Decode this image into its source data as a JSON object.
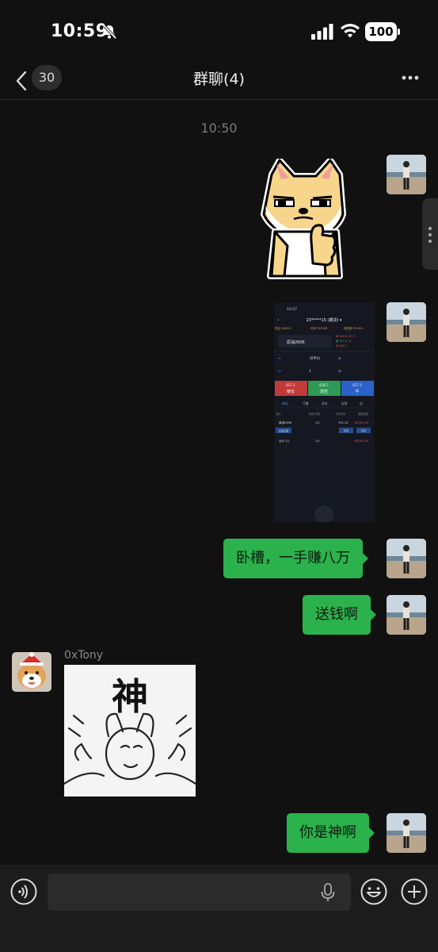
{
  "status_bar": {
    "time": "10:59",
    "battery": "100"
  },
  "nav": {
    "unread_count": "30",
    "title": "群聊(4)"
  },
  "chat": {
    "timestamp": "10:50",
    "messages": [
      {
        "type": "sticker",
        "from": "self"
      },
      {
        "type": "image",
        "from": "self",
        "screenshot": {
          "time": "10:57",
          "account": "23*****15 (期货) ▾",
          "stats": [
            "权益 240401",
            "可用 705926",
            "风险度 59.49%"
          ],
          "contract": "原油2606",
          "price_mode": "对手价",
          "qty": "1",
          "buttons": [
            {
              "price": "617.1",
              "label": "锁仓"
            },
            {
              "price": "616.7",
              "label": "加空"
            },
            {
              "price": "617.1",
              "label": "平"
            }
          ],
          "tabs": [
            "持仓",
            "可撤",
            "成交",
            "走势",
            "自"
          ],
          "headers": [
            "合约",
            "持仓/可用",
            "开仓均价",
            "逐笔浮盈"
          ],
          "row": [
            "原油2606",
            "1/1",
            "701.10",
            "84300.00"
          ],
          "row_buttons": [
            "止损止盈",
            "反手",
            "全平"
          ],
          "total": [
            "合计 (1)",
            "1/1",
            "84300.00"
          ]
        }
      },
      {
        "type": "text",
        "from": "self",
        "text": "卧槽，一手赚八万"
      },
      {
        "type": "text",
        "from": "self",
        "text": "送钱啊"
      },
      {
        "type": "image",
        "from": "other",
        "sender": "0xTony",
        "sticker_char": "神"
      },
      {
        "type": "text",
        "from": "self",
        "text": "你是神啊"
      }
    ]
  },
  "input": {
    "placeholder": ""
  },
  "colors": {
    "bubble": "#2bb24c",
    "background": "#111111",
    "input_bar": "#1c1c1c"
  },
  "icons": [
    "back-chevron-icon",
    "more-icon",
    "voice-icon",
    "mic-icon",
    "emoji-icon",
    "plus-icon",
    "bell-off-icon",
    "signal-icon",
    "wifi-icon"
  ]
}
